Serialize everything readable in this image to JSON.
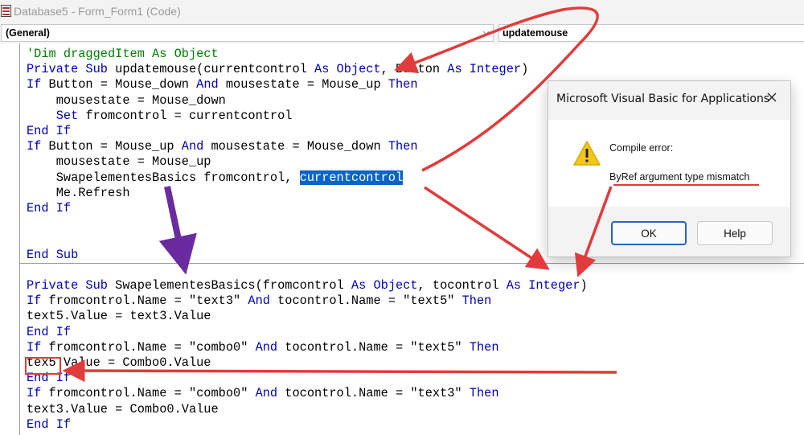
{
  "window": {
    "title": "Database5 - Form_Form1 (Code)",
    "icon": "access-database-icon"
  },
  "object_combo": {
    "value": "(General)",
    "icon": "chevron-down-icon"
  },
  "procedure_combo": {
    "value": "updatemouse"
  },
  "code_lines": [
    [
      [
        "cm",
        "'Dim draggedItem As Object"
      ]
    ],
    [
      [
        "kw",
        "Private Sub"
      ],
      [
        "",
        " updatemouse(currentcontrol "
      ],
      [
        "kw",
        "As Object"
      ],
      [
        "",
        ", Button "
      ],
      [
        "kw",
        "As Integer"
      ],
      [
        "",
        ")"
      ]
    ],
    [
      [
        "kw",
        "If"
      ],
      [
        "",
        " Button = Mouse_down "
      ],
      [
        "kw",
        "And"
      ],
      [
        "",
        " mousestate = Mouse_up "
      ],
      [
        "kw",
        "Then"
      ]
    ],
    [
      [
        "",
        "    mousestate = Mouse_down"
      ]
    ],
    [
      [
        "",
        "    "
      ],
      [
        "kw",
        "Set"
      ],
      [
        "",
        " fromcontrol = currentcontrol"
      ]
    ],
    [
      [
        "kw",
        "End If"
      ]
    ],
    [
      [
        "kw",
        "If"
      ],
      [
        "",
        " Button = Mouse_up "
      ],
      [
        "kw",
        "And"
      ],
      [
        "",
        " mousestate = Mouse_down "
      ],
      [
        "kw",
        "Then"
      ]
    ],
    [
      [
        "",
        "    mousestate = Mouse_up"
      ]
    ],
    [
      [
        "",
        "    SwapelementesBasics fromcontrol, "
      ],
      [
        "sel",
        "currentcontrol"
      ]
    ],
    [
      [
        "",
        "    Me.Refresh"
      ]
    ],
    [
      [
        "kw",
        "End If"
      ]
    ],
    [
      [
        "",
        ""
      ]
    ],
    [
      [
        "",
        ""
      ]
    ],
    [
      [
        "kw",
        "End Sub"
      ]
    ],
    [
      [
        "",
        ""
      ]
    ],
    [
      [
        "kw",
        "Private Sub"
      ],
      [
        "",
        " SwapelementesBasics(fromcontrol "
      ],
      [
        "kw",
        "As Object"
      ],
      [
        "",
        ", tocontrol "
      ],
      [
        "kw",
        "As Integer"
      ],
      [
        "",
        ")"
      ]
    ],
    [
      [
        "kw",
        "If"
      ],
      [
        "",
        " fromcontrol.Name = \"text3\" "
      ],
      [
        "kw",
        "And"
      ],
      [
        "",
        " tocontrol.Name = \"text5\" "
      ],
      [
        "kw",
        "Then"
      ]
    ],
    [
      [
        "",
        "text5.Value = text3.Value"
      ]
    ],
    [
      [
        "kw",
        "End If"
      ]
    ],
    [
      [
        "kw",
        "If"
      ],
      [
        "",
        " fromcontrol.Name = \"combo0\" "
      ],
      [
        "kw",
        "And"
      ],
      [
        "",
        " tocontrol.Name = \"text5\" "
      ],
      [
        "kw",
        "Then"
      ]
    ],
    [
      [
        "",
        "tex5 Value = Combo0.Value"
      ]
    ],
    [
      [
        "kw",
        "End If"
      ]
    ],
    [
      [
        "kw",
        "If"
      ],
      [
        "",
        " fromcontrol.Name = \"combo0\" "
      ],
      [
        "kw",
        "And"
      ],
      [
        "",
        " tocontrol.Name = \"text3\" "
      ],
      [
        "kw",
        "Then"
      ]
    ],
    [
      [
        "",
        "text3.Value = Combo0.Value"
      ]
    ],
    [
      [
        "kw",
        "End If"
      ]
    ]
  ],
  "dialog": {
    "title": "Microsoft Visual Basic for Applications",
    "close_icon": "close-icon",
    "warning_icon": "warning-icon",
    "heading": "Compile error:",
    "message": "ByRef argument type mismatch",
    "ok_label": "OK",
    "help_label": "Help"
  },
  "colors": {
    "keyword": "#0000b4",
    "comment": "#008000",
    "selection": "#0a64c8",
    "annotation_red": "#e23b3b",
    "annotation_purple": "#6a2ba0"
  }
}
